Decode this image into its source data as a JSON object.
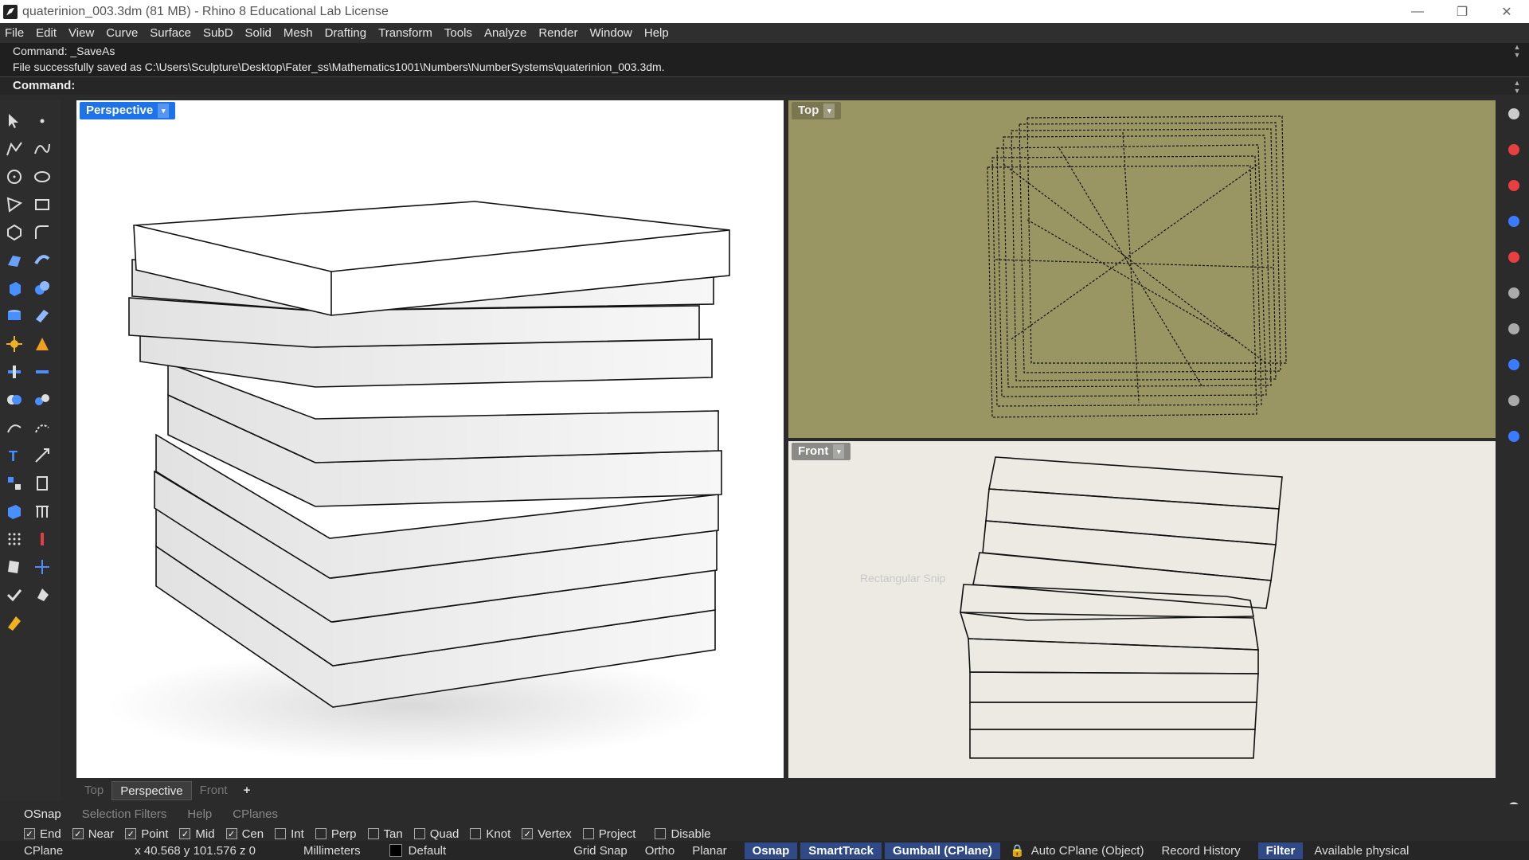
{
  "titlebar": {
    "title": "quaterinion_003.3dm (81 MB) - Rhino 8 Educational Lab License",
    "minimize": "—",
    "maximize": "❐",
    "close": "✕"
  },
  "menu": [
    "File",
    "Edit",
    "View",
    "Curve",
    "Surface",
    "SubD",
    "Solid",
    "Mesh",
    "Drafting",
    "Transform",
    "Tools",
    "Analyze",
    "Render",
    "Window",
    "Help"
  ],
  "command": {
    "history": [
      "Command: _SaveAs",
      "File successfully saved as C:\\Users\\Sculpture\\Desktop\\Fater_ss\\Mathematics1001\\Numbers\\NumberSystems\\quaterinion_003.3dm."
    ],
    "prompt": "Command:"
  },
  "viewports": {
    "perspective": {
      "label": "Perspective",
      "dropdown": "▾"
    },
    "top": {
      "label": "Top",
      "dropdown": "▾"
    },
    "front": {
      "label": "Front",
      "dropdown": "▾",
      "snip_hint": "Rectangular Snip"
    }
  },
  "view_tabs": [
    {
      "label": "Top",
      "active": false
    },
    {
      "label": "Perspective",
      "active": true
    },
    {
      "label": "Front",
      "active": false
    },
    {
      "label": "+",
      "active": false
    }
  ],
  "panel_tabs": [
    {
      "label": "OSnap",
      "active": true
    },
    {
      "label": "Selection Filters",
      "active": false
    },
    {
      "label": "Help",
      "active": false
    },
    {
      "label": "CPlanes",
      "active": false
    }
  ],
  "osnaps": [
    {
      "label": "End",
      "checked": true
    },
    {
      "label": "Near",
      "checked": true
    },
    {
      "label": "Point",
      "checked": true
    },
    {
      "label": "Mid",
      "checked": true
    },
    {
      "label": "Cen",
      "checked": true
    },
    {
      "label": "Int",
      "checked": false
    },
    {
      "label": "Perp",
      "checked": false
    },
    {
      "label": "Tan",
      "checked": false
    },
    {
      "label": "Quad",
      "checked": false
    },
    {
      "label": "Knot",
      "checked": false
    },
    {
      "label": "Vertex",
      "checked": true
    },
    {
      "label": "Project",
      "checked": false
    },
    {
      "label": "Disable",
      "checked": false
    }
  ],
  "status": {
    "cplane": "CPlane",
    "coords": "x 40.568   y 101.576   z 0",
    "units": "Millimeters",
    "layer": "Default",
    "grid_snap": "Grid Snap",
    "ortho": "Ortho",
    "planar": "Planar",
    "osnap": "Osnap",
    "smarttrack": "SmartTrack",
    "gumball": "Gumball (CPlane)",
    "auto_cplane": "Auto CPlane (Object)",
    "record_history": "Record History",
    "filter": "Filter",
    "available": "Available physical"
  },
  "colors": {
    "accent": "#1e73e8",
    "active_status": "#2f4a86",
    "top_viewport_bg": "#9a9664",
    "front_viewport_bg": "#eceae3"
  },
  "left_tools": [
    "select-icon",
    "point-icon",
    "polyline-icon",
    "curve-icon",
    "circle-icon",
    "ellipse-icon",
    "polygon-icon",
    "rectangle-icon",
    "arc-icon",
    "fillet-icon",
    "surface-icon",
    "loft-icon",
    "box-icon",
    "sphere-icon",
    "cylinder-icon",
    "extrude-icon",
    "explode-icon",
    "split-icon",
    "boolean-union-icon",
    "boolean-diff-icon",
    "offset-icon",
    "blend-icon",
    "text-icon",
    "dimension-icon",
    "array-icon",
    "scale-icon",
    "block-icon",
    "grid-icon",
    "matrix-icon",
    "layout-icon",
    "patch-icon",
    "gumball-icon",
    "check-icon",
    "render-icon",
    "paint-icon"
  ],
  "right_tools": [
    "settings-icon",
    "color-wheel-icon",
    "render-icon",
    "materials-icon",
    "paint-icon",
    "layers-icon",
    "camera-icon",
    "notification-icon",
    "learn-icon",
    "help-icon"
  ]
}
